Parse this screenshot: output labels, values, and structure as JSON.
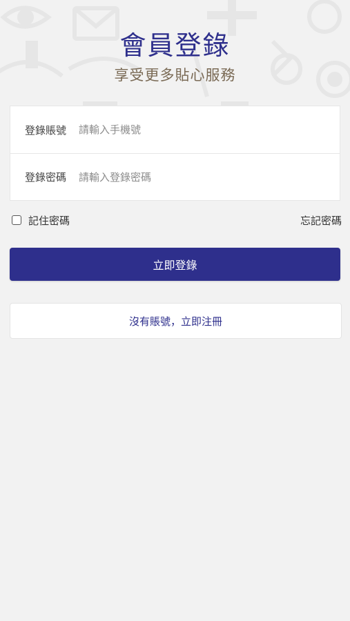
{
  "header": {
    "title": "會員登錄",
    "subtitle": "享受更多貼心服務"
  },
  "form": {
    "account_label": "登錄賬號",
    "account_placeholder": "請輸入手機號",
    "account_value": "",
    "password_label": "登錄密碼",
    "password_placeholder": "請輸入登錄密碼",
    "password_value": ""
  },
  "options": {
    "remember_label": "記住密碼",
    "remember_checked": false,
    "forgot_label": "忘記密碼"
  },
  "actions": {
    "login_label": "立即登錄",
    "register_label": "沒有賬號，立即注冊"
  },
  "colors": {
    "brand": "#2e2f8c",
    "subtitle": "#7a6a55",
    "background": "#f2f2f2"
  },
  "icons": {
    "background_pattern": "decorative-doodle-icons"
  }
}
